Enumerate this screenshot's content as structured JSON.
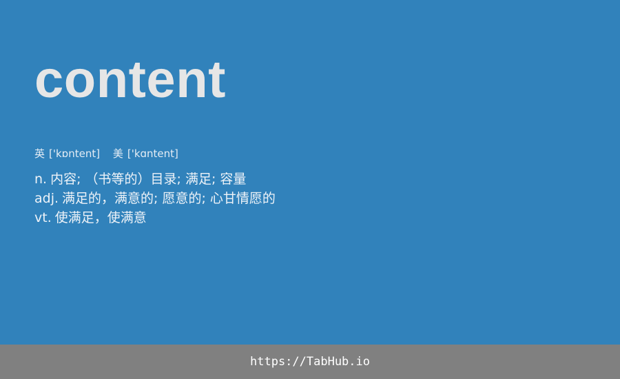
{
  "word": "content",
  "phonetics": [
    {
      "label": "英",
      "ipa": "['kɒntent]"
    },
    {
      "label": "美",
      "ipa": "['kɑntent]"
    }
  ],
  "definitions": [
    {
      "pos": "n.",
      "meaning": "内容; （书等的）目录; 满足; 容量"
    },
    {
      "pos": "adj.",
      "meaning": "满足的，满意的; 愿意的; 心甘情愿的"
    },
    {
      "pos": "vt.",
      "meaning": "使满足，使满意"
    }
  ],
  "footer": {
    "link_text": "https://TabHub.io"
  },
  "colors": {
    "background": "#3182bb",
    "footer_background": "#808080",
    "word_text": "#e6e6e6",
    "text": "#ffffff"
  }
}
